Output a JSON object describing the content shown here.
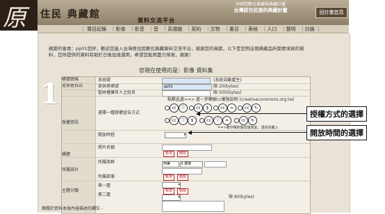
{
  "header": {
    "logo_char": "原",
    "site_name": "住民 典藏館",
    "platform_title": "資料交流平台",
    "institution_lines": [
      "中研院數位典藏與典藏計畫",
      "台灣原住民族的典藏計畫"
    ],
    "home_button": "回計畫首頁"
  },
  "nav": {
    "items": [
      "｜ 覽目紀錄",
      "｜影像",
      "｜影音",
      "｜音",
      "｜系譜圖",
      "｜契約",
      "｜文物",
      "｜書目",
      "｜表格",
      "｜人口",
      "｜聲明",
      "｜討論 ｜"
    ]
  },
  "intro": {
    "text": "親愛的會員：pp01您好，歡迎您進入台灣原住民數位典藏資料交流平台，感謝您的貢獻，以下是您對這個典藏品所需要填寫的資料，您所提供的資料有助於日後加值運用，希望您能用盡力填寫，謝謝！",
    "using_line": "您現在使用的是：影像 資料集"
  },
  "section_number": "1",
  "form": {
    "cat_account": "帳號密碼",
    "cat_provider": "提供者資訊",
    "cat_license": "授權資訊",
    "cat_title": "標題",
    "cat_tribe": "所屬族社",
    "cat_topic": "主題分類",
    "label_system_id": "系統號",
    "label_provider_account": "提供者帳號",
    "label_owner_name": "智財權擁有人之姓名",
    "label_license_choose": "選擇一種授權宣告方式",
    "label_open_time": "開放時程",
    "label_photo_name": "照片名稱",
    "label_tribe": "所屬族群",
    "label_community": "所屬部落",
    "label_cat1": "第一層",
    "label_cat2": "第二層",
    "system_note": "(系統自動產生)",
    "account_value": "pp01",
    "account_note": "限 20(bytes)",
    "owner_note": "限 500(bytes)",
    "license_hint": "點擊此處==> 進一步瞭解cc權限說明 (creativecommons.org.tw)",
    "license_note": "==>著作權依據您填寫此，請含括載入",
    "tribe_select": "阿美",
    "community_select": "Ⅱ 選擇",
    "btn_add": "新增",
    "btn_delete": "刪除",
    "limit_note": "限 80(bytes)"
  },
  "callouts": {
    "license": "授權方式的選擇",
    "open_time": "開放時間的選擇"
  },
  "footer": {
    "text": "面關於資料本身內容描述的欄位 -"
  }
}
